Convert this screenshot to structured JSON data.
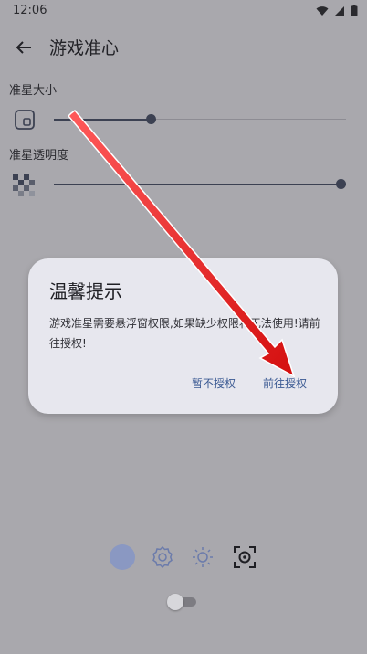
{
  "status_bar": {
    "time": "12:06",
    "icons": [
      "wifi-icon",
      "signal-icon",
      "battery-icon"
    ]
  },
  "app_bar": {
    "title": "游戏准心",
    "back_icon": "arrow-back-icon"
  },
  "settings": [
    {
      "label": "准星大小",
      "icon": "crosshair-size-icon",
      "value_percent": 33
    },
    {
      "label": "准星透明度",
      "icon": "transparency-checker-icon",
      "value_percent": 100
    }
  ],
  "dialog": {
    "title": "温馨提示",
    "message": "游戏准星需要悬浮窗权限,如果缺少权限将无法使用!请前往授权!",
    "cancel_label": "暂不授权",
    "confirm_label": "前往授权"
  },
  "bottom_icons": [
    "color-dot-icon",
    "gear-icon",
    "brightness-icon",
    "crosshair-target-icon"
  ],
  "toggle": {
    "on": false
  },
  "colors": {
    "background": "#a9a8ad",
    "dialog": "#e7e7ee",
    "accent": "#3b5a93",
    "color_dot": "#8a98c2",
    "arrow": "#e01b1b"
  }
}
